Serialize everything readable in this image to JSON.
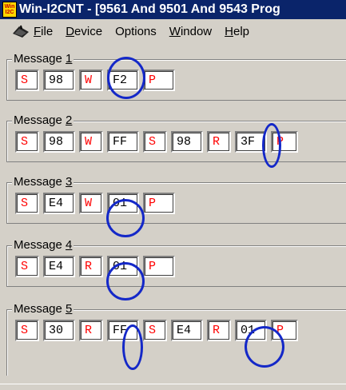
{
  "window": {
    "title": "Win-I2CNT - [9561 And 9501 And 9543 Prog",
    "icon_text_top": "Win",
    "icon_text_bottom": "I2C"
  },
  "menu": {
    "items": [
      {
        "label": "File",
        "accel": "F",
        "rest": "ile"
      },
      {
        "label": "Device",
        "accel": "D",
        "rest": "evice"
      },
      {
        "label": "Options",
        "accel": "",
        "rest": "Options"
      },
      {
        "label": "Window",
        "accel": "W",
        "rest": "indow"
      },
      {
        "label": "Help",
        "accel": "H",
        "rest": "elp"
      }
    ]
  },
  "messages": [
    {
      "title": "Message ",
      "num": "1",
      "boxes": [
        "S",
        "98",
        "W",
        "F2",
        "P"
      ]
    },
    {
      "title": "Message ",
      "num": "2",
      "boxes": [
        "S",
        "98",
        "W",
        "FF",
        "S",
        "98",
        "R",
        "3F",
        "P"
      ]
    },
    {
      "title": "Message ",
      "num": "3",
      "boxes": [
        "S",
        "E4",
        "W",
        "01",
        "P"
      ]
    },
    {
      "title": "Message ",
      "num": "4",
      "boxes": [
        "S",
        "E4",
        "R",
        "01",
        "P"
      ]
    },
    {
      "title": "Message ",
      "num": "5",
      "boxes": [
        "S",
        "30",
        "R",
        "FF",
        "S",
        "E4",
        "R",
        "01",
        "P"
      ]
    }
  ],
  "colors": {
    "control_char": "#ff0000",
    "annotation_ellipse": "#1428c8",
    "titlebar": "#0a246a"
  }
}
